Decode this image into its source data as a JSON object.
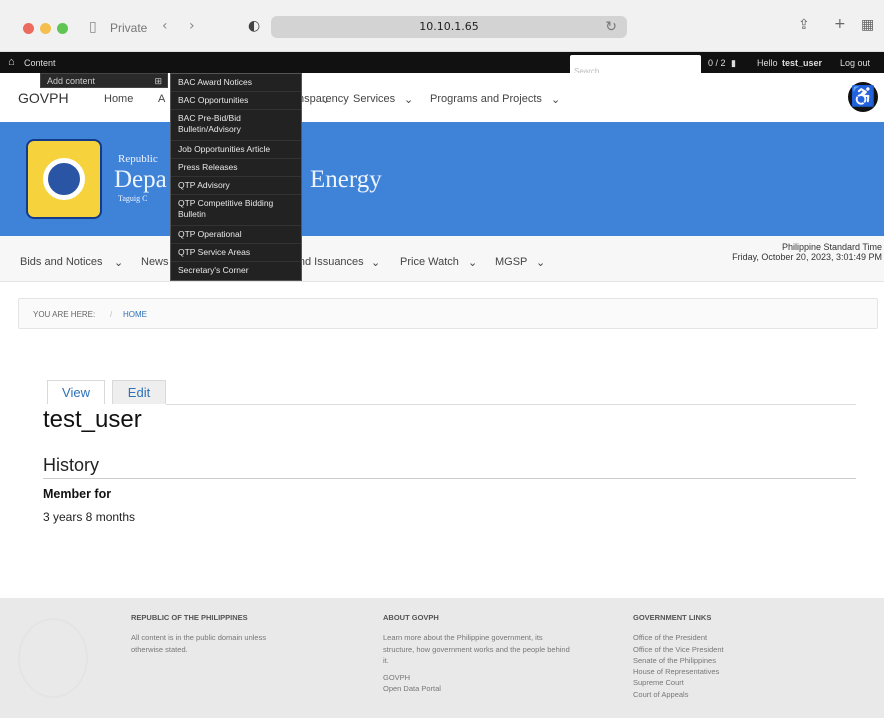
{
  "browser": {
    "mode_label": "Private",
    "url": "10.10.1.65"
  },
  "admin": {
    "content_label": "Content",
    "search_placeholder": "Search",
    "counter": "0 / 2",
    "greeting": "Hello",
    "username": "test_user",
    "logout": "Log out",
    "add_content": "Add content",
    "dropdown_items": [
      "BAC Award Notices",
      "BAC Opportunities",
      "BAC Pre-Bid/Bid Bulletin/Advisory",
      "Job Opportunities Article",
      "Press Releases",
      "QTP Advisory",
      "QTP Competitive Bidding Bulletin",
      "QTP Operational",
      "QTP Service Areas",
      "Secretary's Corner"
    ]
  },
  "gov_nav": {
    "logo": "GOVPH",
    "items": [
      "Home",
      "A",
      "nsparency",
      "Services",
      "Programs and Projects"
    ]
  },
  "banner": {
    "republic": "Republic",
    "dept_left": "Depa",
    "dept_right": "Energy",
    "location": "Taguig C"
  },
  "main_menu": {
    "items": [
      "Bids and Notices",
      "News",
      "Laws and Issuances",
      "Price Watch",
      "MGSP"
    ],
    "clock_label": "Philippine Standard Time",
    "clock_value": "Friday, October 20, 2023, 3:01:49 PM"
  },
  "breadcrumb": {
    "label": "YOU ARE HERE:",
    "home": "HOME"
  },
  "tabs": {
    "view": "View",
    "edit": "Edit"
  },
  "profile": {
    "name": "test_user",
    "section": "History",
    "member_label": "Member for",
    "member_value": "3 years 8 months"
  },
  "footer": {
    "republic_title": "REPUBLIC OF THE PHILIPPINES",
    "republic_text": "All content is in the public domain unless otherwise stated.",
    "about_title": "ABOUT GOVPH",
    "about_text": "Learn more about the Philippine government, its structure, how government works and the people behind it.",
    "govph": "GOVPH",
    "open_data": "Open Data Portal",
    "links_title": "GOVERNMENT LINKS",
    "links": [
      "Office of the President",
      "Office of the Vice President",
      "Senate of the Philippines",
      "House of Representatives",
      "Supreme Court",
      "Court of Appeals"
    ]
  },
  "colors": {
    "banner": "#3f83d8",
    "link": "#2d71b8",
    "admin_bar": "#111111"
  }
}
